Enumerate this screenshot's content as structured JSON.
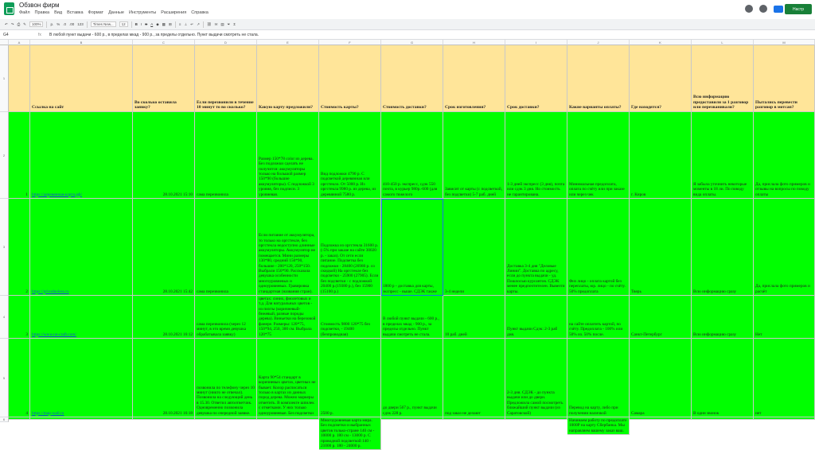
{
  "app": {
    "title": "Обзвон фирм",
    "menus": [
      "Файл",
      "Правка",
      "Вид",
      "Вставка",
      "Формат",
      "Данные",
      "Инструменты",
      "Расширения",
      "Справка"
    ],
    "share_label": "Настр"
  },
  "toolbar": {
    "zoom": "100%",
    "currency": "р.",
    "percent": "%",
    "dec1": ".0",
    "dec2": ".00",
    "format123": "123",
    "font": "Times New...",
    "font_size": "12",
    "bold": "B",
    "italic": "I",
    "strike": "S",
    "textcolor": "A"
  },
  "formula": {
    "cell_ref": "G4",
    "fx": "fx",
    "text": "В любой пункт выдачи - 600 р., в пределах мкад - 900 р., за пределы отдельно. Пункт выдачи смотреть не стала."
  },
  "sheet": {
    "columns": [
      "A",
      "B",
      "C",
      "D",
      "E",
      "F",
      "G",
      "H",
      "I",
      "J",
      "K",
      "L",
      "M"
    ],
    "header_row_num": "1",
    "headers": [
      "",
      "Ссылка на сайт",
      "Во сколько оставила заявку?",
      "Если перезвонили в течение 10 минут то во сколько?",
      "Какую карту предложили?",
      "Стоимость карты?",
      "Стоимость доставки?",
      "Срок изготовления?",
      "Срок доставки?",
      "Какие варианты оплаты?",
      "Где находятся?",
      "Всю информацию предоставили за 1 разговор или перезванивали?",
      "Пытались перевести разговор в мотсап?"
    ],
    "rows": [
      {
        "num": "2",
        "cells": [
          "1",
          "https://деревянная-карта.рф/",
          "28.10.2021 15:10",
          "сама перезвонила",
          "Размер 150*78 color из дерева. Без подложки сделать не получится: аккумуляторы только на большой размер 150*90 (большие аккумуляторы). С подложкой 3 уровня, без подписи. 3 уровневая.",
          "Вид подложки 4790 р. С подсветкой деревянная или оргстекло. От 5000 р. Из оргстекла 9980 р. из дерева, из деревянной 7580 р.",
          "410-450 р. экспресс, сдэк 550 почта, в курьер 980р.-600 (для самого тяжелого",
          "Зависит от карты (с подсветкой, без подсветки) 5-7 раб. дней",
          "1-3 дней экспресс (3 дня), почта или сдэк 3 дня. Но стоимость не гарантирована.",
          "Минимальная предоплата, оплата по счёту или при заказе или через чек",
          "г. Киров",
          "Я забыла уточнить некоторые моменты в 18 ли. По поводу вида оплаты.",
          "Да, прислала фото примеров и отзывы на вопросы по поводу оплаты"
        ]
      },
      {
        "num": "3",
        "cells": [
          "2",
          "https://prirodnoless.ru",
          "28.10.2021 15:42",
          "сама перезвонила",
          "Если питание от аккумулятора, то только на оргстекле, без оргстекла недоступно длинные аккумуляторы. Аккумулятор не помещается. Мини размеры 130*80, средний 150*90, большие - 200*120, 250*150. Выбрали 150*90. Рассказала девушка особенности многоуровневых и одноуровневых. Гравировка стандартная (названия стран).",
          "Подложка из оргстекла 31600 р. (-5% при заказе на сайте 30020 р. - заказ). От сети если питание. Подсветка без подложки - 28400 (26980 р. со скидкой) На оргстекле без подсветки - 25900 (27905). Если без подсветки - с подложкой 20400 р.(19380 р.), без 15900 (15100 р.)",
          "1800 р - доставка для карты, экспресс - выше. СДЭК также",
          "3-4 недели",
          "Доставка 3-4 дня \"Деловые Линии\". Доставка по адресу, если до пункта выдачи - уд. Пошлосью курсантов. СДЭК менее предпочтителен. Вывезти карты.",
          "Физ лицо - оплата картой без переплаты, юр. лицо - по счёту. 50% предоплата",
          "Тверь",
          "Всю информацию сразу",
          "Да, прислала фото примеров и расчёт"
        ]
      },
      {
        "num": "4",
        "cells": [
          "3",
          "https://www.nn-craft.com/",
          "28.10.2021 16:12",
          "сама перезвонила (через 12 минут, в это время девушка обрабатывала заявку)",
          "Вариант с подсветкой на подложки из оргстекла. Многоуровневая у них все на подложки. Окрас в нескольких цветах: синих, фиолетовых и т.д. Для натуральных цветов - из пихты (коричневый-бежевый, разные породы дерева). Виньетки на березовой фанере. Размеры: 120*75, 150*94, 250, 300 см. Выбрала 120*75",
          "Стоимость 9800 120*75 без подсветки, - 19400 (безпроводная)",
          "В любой пункт выдачи - 600 р., в пределах мкад - 900 р., за пределы отдельно. Пункт выдачи смотреть не стала.",
          "10 раб. дней",
          "Пункт выдачи Сдэк: 2-3 раб дня.",
          "на сайте оплатить картой, по счёту. Предоплата - 100% или 50% из. 50% после.",
          "Санкт-Петербург",
          "Всю информацию сразу",
          "Нет"
        ]
      },
      {
        "num": "5",
        "cells": [
          "4",
          "https://map-wall.ru",
          "28.10.2021 16:18",
          "позвонила по телефону через 10 минут (никто не отвечал). Позвонила на следующий день в 15.30. Ответил автоответчик. Одновременно позвонила девушка по очередной заявке.",
          "Карта 90*54 стандарт в коричневых цветах, цветных не бывает. Колор расписаться только в картах из данных пород дерева. Можно маркеры отметить. В комплекте шпилек с отметками. У них только одноуровневые. Без подсветки",
          "2500 р.",
          "до двери 567 р., пункт выдачи сдэк 228 р.",
          "под заказ не делают",
          "2-3 дня. СДЭК - до пункта выдачи или до двери. Предложила самой посмотреть ближайший пункт выдачи (из Саратовской)",
          "Перевод на карту, либо при получении наличкой",
          "Самара",
          "В один звонок",
          "нет"
        ]
      },
      {
        "num": "6",
        "cells": [
          "",
          "",
          "",
          "",
          "",
          "Многоуровневая карта мира. Без подсветки и выбранных цветов только-стране 140 см - 10000 р. 180 см - 13000 р. С проводной подсветкой 140 - 21000 р. 180 - 24000 р.",
          "",
          "",
          "",
          "Начинаем работу по предоплате 1000Р на карту Сбербанка. Мы направляем вашему заказ ваш.",
          "",
          "",
          ""
        ]
      }
    ]
  }
}
